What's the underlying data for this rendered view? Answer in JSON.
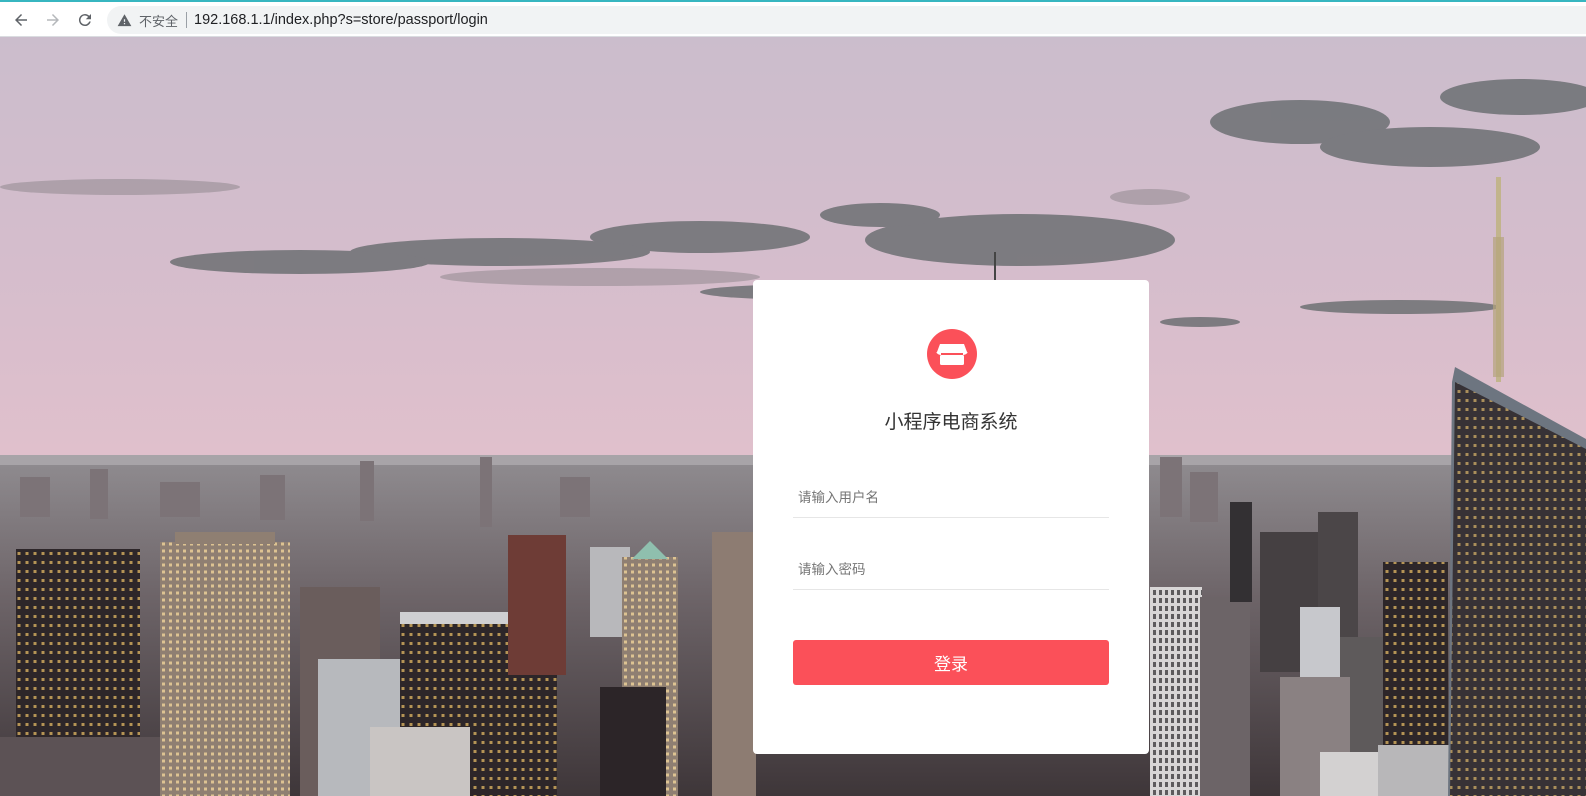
{
  "browser": {
    "security_text": "不安全",
    "url": "192.168.1.1/index.php?s=store/passport/login",
    "icons": [
      "back-arrow-icon",
      "forward-arrow-icon",
      "reload-icon",
      "warning-icon"
    ]
  },
  "login": {
    "title": "小程序电商系统",
    "username_placeholder": "请输入用户名",
    "password_placeholder": "请输入密码",
    "submit_label": "登录",
    "logo_icon": "storefront-icon"
  },
  "colors": {
    "accent": "#fb5059",
    "toolbar_top_line": "#37b6c0"
  }
}
